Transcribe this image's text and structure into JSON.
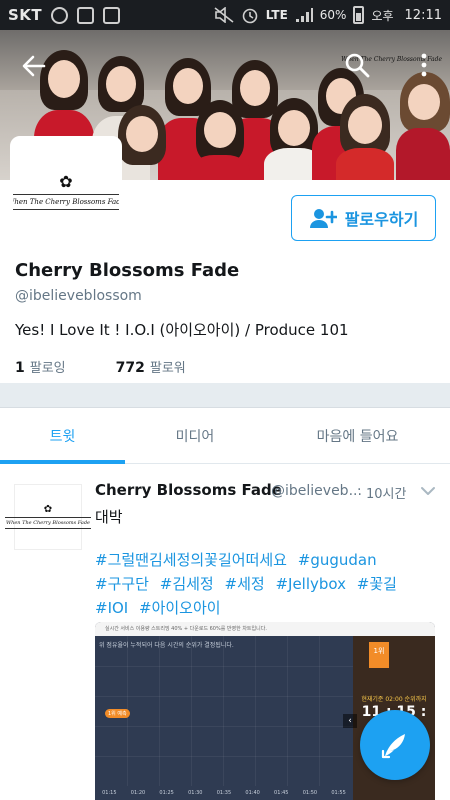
{
  "status_bar": {
    "carrier": "SKT",
    "network": "LTE",
    "battery": "60%",
    "ampm": "오후",
    "time": "12:11"
  },
  "banner": {
    "watermark": "When The Cherry Blossoms Fade"
  },
  "profile": {
    "logo_text": "When The Cherry Blossoms Fade",
    "name": "Cherry Blossoms Fade",
    "handle": "@ibelieveblossom",
    "bio": "Yes! I Love It !  I.O.I (아이오아이) / Produce 101",
    "following_count": "1",
    "following_label": "팔로잉",
    "followers_count": "772",
    "followers_label": "팔로워",
    "follow_button_label": "팔로우하기"
  },
  "tabs": [
    {
      "label": "트윗",
      "active": true
    },
    {
      "label": "미디어",
      "active": false
    },
    {
      "label": "마음에 들어요",
      "active": false
    }
  ],
  "tweet": {
    "name": "Cherry Blossoms Fade",
    "handle": "@ibelieveb...",
    "separator": "·",
    "time": "10시간",
    "text": "대박",
    "hashtags": [
      "#그럴땐김세정의꽃길어떠세요",
      "#gugudan",
      "#구구단",
      "#김세정",
      "#세정",
      "#Jellybox",
      "#꽃길",
      "#IOI",
      "#아이오아이"
    ],
    "media": {
      "top_text": "실시간 서비스 이용량 스트리밍 40% + 다운로드 60%를 반영한 차트입니다.",
      "chart_caption": "위 점유율이 누적되어 다음 시간의 순위가 결정됩니다.",
      "marker_label": "1위 예측",
      "axis_ticks": [
        "01:15",
        "01:20",
        "01:25",
        "01:30",
        "01:35",
        "01:40",
        "01:45",
        "01:50",
        "01:55"
      ],
      "rank_badge": "1위",
      "countdown_label": "현재기준 02:00 순위까지",
      "countdown": "11 : 15 :"
    }
  },
  "colors": {
    "accent": "#1da1f2",
    "link": "#1b95e0",
    "muted": "#657786"
  }
}
